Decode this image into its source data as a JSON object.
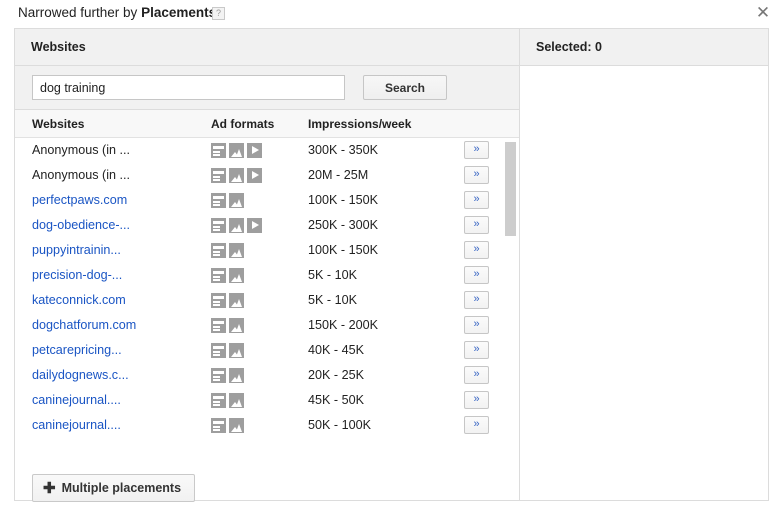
{
  "dialog": {
    "title_prefix": "Narrowed further by ",
    "title_strong": "Placements",
    "help_icon": "?",
    "close_icon": "✕"
  },
  "left_panel": {
    "header": "Websites",
    "search": {
      "value": "dog training",
      "placeholder": "",
      "button_label": "Search"
    },
    "columns": {
      "websites": "Websites",
      "ad_formats": "Ad formats",
      "impressions": "Impressions/week"
    },
    "add_button_label": "»",
    "rows": [
      {
        "site": "Anonymous (in ...",
        "is_link": false,
        "formats": [
          "text",
          "image",
          "video"
        ],
        "impressions": "300K - 350K"
      },
      {
        "site": "Anonymous (in ...",
        "is_link": false,
        "formats": [
          "text",
          "image",
          "video"
        ],
        "impressions": "20M - 25M"
      },
      {
        "site": "perfectpaws.com",
        "is_link": true,
        "formats": [
          "text",
          "image"
        ],
        "impressions": "100K - 150K"
      },
      {
        "site": "dog-obedience-...",
        "is_link": true,
        "formats": [
          "text",
          "image",
          "video"
        ],
        "impressions": "250K - 300K"
      },
      {
        "site": "puppyintrainin...",
        "is_link": true,
        "formats": [
          "text",
          "image"
        ],
        "impressions": "100K - 150K"
      },
      {
        "site": "precision-dog-...",
        "is_link": true,
        "formats": [
          "text",
          "image"
        ],
        "impressions": "5K - 10K"
      },
      {
        "site": "kateconnick.com",
        "is_link": true,
        "formats": [
          "text",
          "image"
        ],
        "impressions": "5K - 10K"
      },
      {
        "site": "dogchatforum.com",
        "is_link": true,
        "formats": [
          "text",
          "image"
        ],
        "impressions": "150K - 200K"
      },
      {
        "site": "petcarepricing...",
        "is_link": true,
        "formats": [
          "text",
          "image"
        ],
        "impressions": "40K - 45K"
      },
      {
        "site": "dailydognews.c...",
        "is_link": true,
        "formats": [
          "text",
          "image"
        ],
        "impressions": "20K - 25K"
      },
      {
        "site": "caninejournal....",
        "is_link": true,
        "formats": [
          "text",
          "image"
        ],
        "impressions": "45K - 50K"
      },
      {
        "site": "caninejournal....",
        "is_link": true,
        "formats": [
          "text",
          "image"
        ],
        "impressions": "50K - 100K"
      }
    ],
    "footer": {
      "plus_icon": "✚",
      "multiple_placements_label": "Multiple placements"
    }
  },
  "right_panel": {
    "header": "Selected: 0"
  },
  "colors": {
    "link": "#1a55c4",
    "header_bg": "#f1f1f1",
    "border": "#dcdcdc",
    "icon_gray": "#9e9e9e"
  }
}
